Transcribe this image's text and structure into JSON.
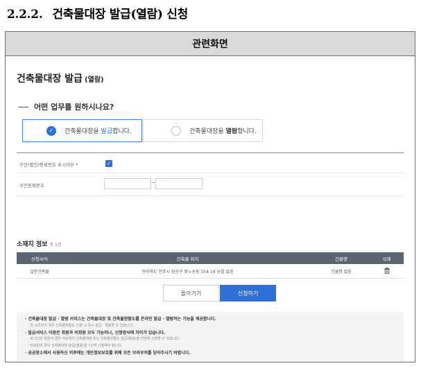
{
  "doc": {
    "section_number": "2.2.2.",
    "section_title": "건축물대장 발급(열람) 신청"
  },
  "frame": {
    "header": "관련화면"
  },
  "page": {
    "title": "건축물대장 발급",
    "title_sub": "(열람)",
    "question": "어떤 업무를 원하시나요?"
  },
  "choices": {
    "issue": {
      "pre": "건축물대장을 ",
      "em": "발급",
      "post": "합니다.",
      "selected": true
    },
    "view": {
      "pre": "건축물대장을 ",
      "em": "열람",
      "post": "합니다.",
      "selected": false
    }
  },
  "form": {
    "rrn_display_label": "주민(법인)등록번호 표시여부 *",
    "rrn_display_checked": true,
    "rrn_label": "주민등록번호",
    "rrn_front_value": "",
    "rrn_back_value": "",
    "rrn_separator": "-"
  },
  "location": {
    "title": "소재지 정보",
    "count_prefix": "총",
    "count": "1건",
    "columns": [
      "신청서식",
      "건축물 위치",
      "건물명",
      "삭제"
    ],
    "rows": [
      {
        "form": "일반건축물",
        "address": "전라북도 전주시 완산구 중노송동 354-19 농협 없음",
        "building": "건물명 없음",
        "delete_icon": "trash-icon"
      }
    ]
  },
  "buttons": {
    "back": "돌아가기",
    "apply": "신청하기"
  },
  "notice": {
    "lines": [
      {
        "type": "main",
        "text": "· 건축물대장 발급 · 열람 서비스는 건축물대장 및 건축물현황도를 온라인 발급 · 열람하는 기능을 제공합니다."
      },
      {
        "type": "sub",
        "text": "- 현 소유자의 경우 건축물현황도 신청 시 즉시 발급 · 열람할 수 있습니다."
      },
      {
        "type": "main",
        "text": "· 발급서비스 이용은 회원과 비회원 모두 가능하나, 신청방식에 차이가 있습니다."
      },
      {
        "type": "sub",
        "text": "- 로그인한 회원의 경우 여러개의 건축물대장 또는 건축물현황도 발급(열람)을 한번에 신청할 수 있습니다."
      },
      {
        "type": "sub",
        "text": "- 비회원의 경우 건축물대장 발급(열람)을 1건씩 신청해야 합니다."
      },
      {
        "type": "main",
        "text": "· 공공장소에서 사용하신 이후에는 개인정보보호를 위해 모든 브라우저를 닫아주시기 바랍니다."
      }
    ]
  },
  "colors": {
    "accent": "#2f6fd6",
    "table_header": "#5a6472",
    "frame_header": "#d9d9d9",
    "notice_bg": "#f3f3f3"
  }
}
